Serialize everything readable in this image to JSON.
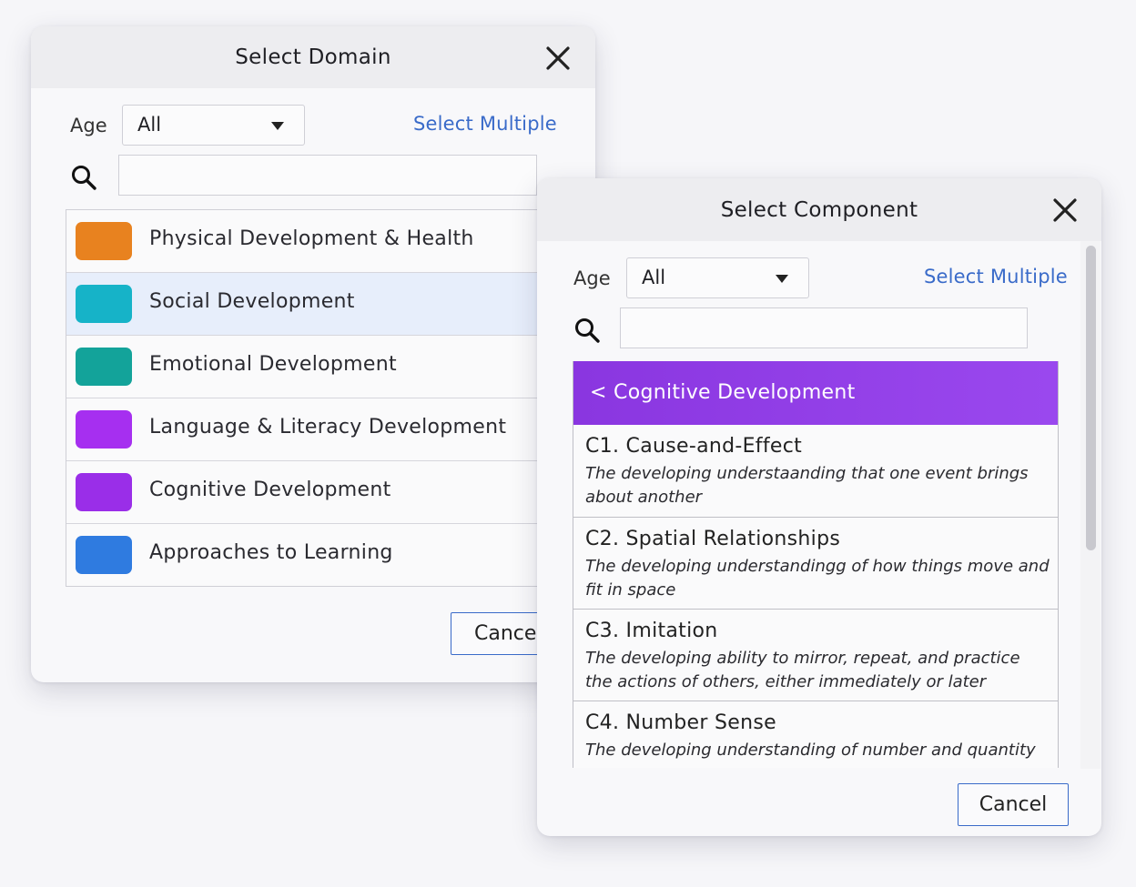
{
  "domain_dialog": {
    "title": "Select Domain",
    "age_label": "Age",
    "age_value": "All",
    "select_multiple": "Select Multiple",
    "search_value": "",
    "items": [
      {
        "label": "Physical Development & Health",
        "color": "#e8821f"
      },
      {
        "label": "Social Development",
        "color": "#16b3c8"
      },
      {
        "label": "Emotional Development",
        "color": "#13a39a"
      },
      {
        "label": "Language & Literacy Development",
        "color": "#a62ff0"
      },
      {
        "label": "Cognitive Development",
        "color": "#9a2ee8"
      },
      {
        "label": "Approaches to Learning",
        "color": "#2f7be0"
      }
    ],
    "highlighted_index": 1,
    "cancel_label": "Cance"
  },
  "component_dialog": {
    "title": "Select Component",
    "age_label": "Age",
    "age_value": "All",
    "select_multiple": "Select Multiple",
    "search_value": "",
    "back_label": "< Cognitive Development",
    "back_color": "#9140e8",
    "items": [
      {
        "title": "C1. Cause-and-Effect",
        "desc": "The developing understaanding that one event brings about another"
      },
      {
        "title": "C2. Spatial Relationships",
        "desc": "The developing understandingg of how things move and fit in space"
      },
      {
        "title": "C3. Imitation",
        "desc": "The developing ability to mirror, repeat, and practice the actions of others, either immediately or later"
      },
      {
        "title": "C4. Number Sense",
        "desc": "The developing understanding of number and quantity"
      }
    ],
    "cancel_label": "Cancel"
  },
  "icons": {
    "close": "close-icon",
    "search": "search-icon",
    "dropdown": "chevron-down-icon"
  },
  "colors": {
    "accent": "#3a6bc9",
    "highlight_row": "#e7eefb"
  }
}
